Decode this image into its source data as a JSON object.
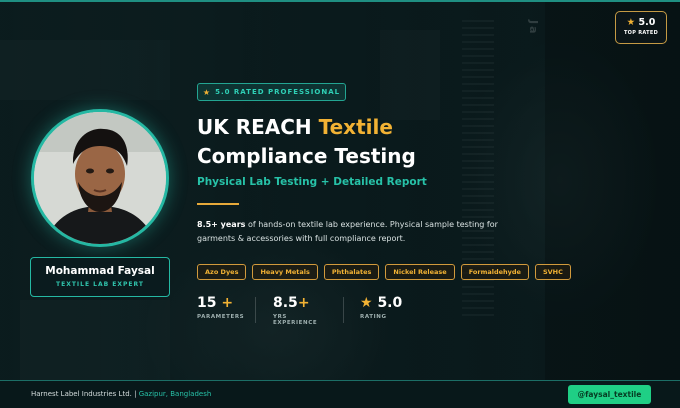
{
  "top_badge": {
    "star_icon": "★",
    "score": "5.0",
    "label": "TOP RATED"
  },
  "watermark": "Ja",
  "profile": {
    "name": "Mohammad Faysal",
    "role": "TEXTILE LAB EXPERT"
  },
  "rated_badge": {
    "star_icon": "★",
    "text": "5.0 RATED PROFESSIONAL"
  },
  "headline": {
    "line1_white": "UK REACH ",
    "line1_accent": "Textile",
    "line2": "Compliance Testing"
  },
  "subheadline": "Physical Lab Testing + Detailed Report",
  "description": {
    "highlight": "8.5+ years",
    "rest": " of hands-on textile lab experience. Physical sample testing for garments & accessories with full compliance report."
  },
  "tags": [
    "Azo Dyes",
    "Heavy Metals",
    "Phthalates",
    "Nickel Release",
    "Formaldehyde",
    "SVHC"
  ],
  "stats": [
    {
      "value": "15",
      "suffix": "+",
      "label": "PARAMETERS"
    },
    {
      "value": "8.5",
      "suffix": "+",
      "label": "YRS EXPERIENCE"
    },
    {
      "prefix": "★",
      "value": "5.0",
      "label": "RATING"
    }
  ],
  "footer": {
    "company": "Harnest Label Industries Ltd.",
    "separator": "|",
    "location": "Gazipur, Bangladesh",
    "handle": "@faysal_textile"
  },
  "colors": {
    "teal": "#25b8a3",
    "gold": "#f2b234",
    "green_button": "#1fcf85",
    "background": "#0b1a1c"
  }
}
